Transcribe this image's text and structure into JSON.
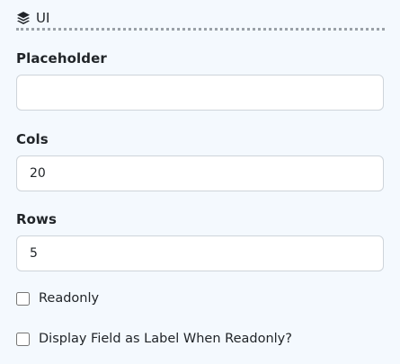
{
  "section": {
    "title": "UI",
    "icon": "layers-icon"
  },
  "fields": {
    "placeholder": {
      "label": "Placeholder",
      "value": "",
      "placeholder": ""
    },
    "cols": {
      "label": "Cols",
      "value": "20"
    },
    "rows": {
      "label": "Rows",
      "value": "5"
    }
  },
  "checkboxes": {
    "readonly": {
      "label": "Readonly",
      "checked": false
    },
    "display_as_label": {
      "label": "Display Field as Label When Readonly?",
      "checked": false
    }
  }
}
